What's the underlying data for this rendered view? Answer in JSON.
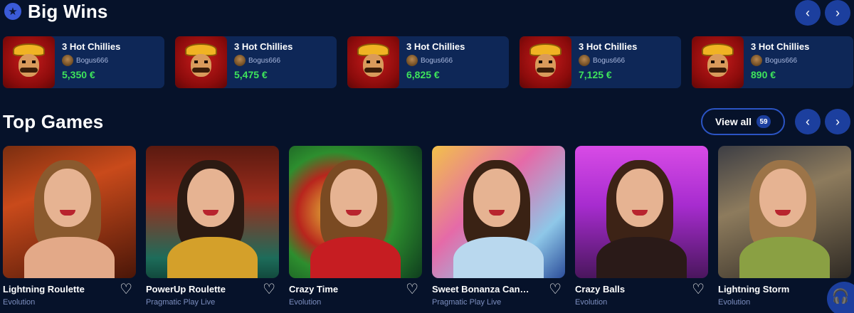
{
  "big_wins": {
    "title": "Big Wins",
    "icon": "star-icon",
    "prev_icon": "‹",
    "next_icon": "›",
    "items": [
      {
        "game": "3 Hot Chillies",
        "user": "Bogus666",
        "amount": "5,350 €"
      },
      {
        "game": "3 Hot Chillies",
        "user": "Bogus666",
        "amount": "5,475 €"
      },
      {
        "game": "3 Hot Chillies",
        "user": "Bogus666",
        "amount": "6,825 €"
      },
      {
        "game": "3 Hot Chillies",
        "user": "Bogus666",
        "amount": "7,125 €"
      },
      {
        "game": "3 Hot Chillies",
        "user": "Bogus666",
        "amount": "890 €"
      }
    ]
  },
  "top_games": {
    "title": "Top Games",
    "view_all_label": "View all",
    "count": "59",
    "prev_icon": "‹",
    "next_icon": "›",
    "items": [
      {
        "title": "Lightning Roulette",
        "provider": "Evolution"
      },
      {
        "title": "PowerUp Roulette",
        "provider": "Pragmatic Play Live"
      },
      {
        "title": "Crazy Time",
        "provider": "Evolution"
      },
      {
        "title": "Sweet Bonanza CandyLa...",
        "provider": "Pragmatic Play Live"
      },
      {
        "title": "Crazy Balls",
        "provider": "Evolution"
      },
      {
        "title": "Lightning Storm",
        "provider": "Evolution"
      }
    ]
  },
  "colors": {
    "background": "#06122a",
    "card": "#0e2757",
    "accent": "#1c3f9e",
    "win_amount": "#3ee35b",
    "provider_text": "#7d8fc0"
  },
  "icons": {
    "heart": "heart-icon",
    "support": "headset-icon"
  }
}
